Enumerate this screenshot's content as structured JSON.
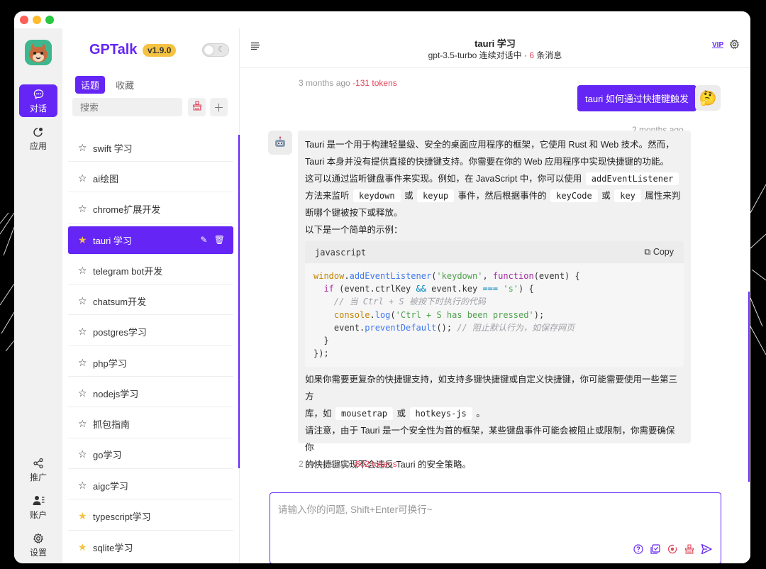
{
  "sidebar_rail": {
    "items": [
      {
        "label": "对话",
        "icon": "chat-bubble-icon",
        "active": true
      },
      {
        "label": "应用",
        "icon": "apps-icon",
        "active": false
      },
      {
        "label": "推广",
        "icon": "share-icon",
        "active": false
      },
      {
        "label": "账户",
        "icon": "account-icon",
        "active": false
      },
      {
        "label": "设置",
        "icon": "settings-icon",
        "active": false
      }
    ]
  },
  "sidebar": {
    "brand": "GPTalk",
    "version": "v1.9.0",
    "tabs": [
      {
        "label": "话题",
        "active": true
      },
      {
        "label": "收藏",
        "active": false
      }
    ],
    "search_placeholder": "搜索",
    "conversations": [
      {
        "title": "swift 学习",
        "starred": false,
        "active": false
      },
      {
        "title": "ai绘图",
        "starred": false,
        "active": false
      },
      {
        "title": "chrome扩展开发",
        "starred": false,
        "active": false
      },
      {
        "title": "tauri 学习",
        "starred": true,
        "active": true
      },
      {
        "title": "telegram bot开发",
        "starred": false,
        "active": false
      },
      {
        "title": "chatsum开发",
        "starred": false,
        "active": false
      },
      {
        "title": "postgres学习",
        "starred": false,
        "active": false
      },
      {
        "title": "php学习",
        "starred": false,
        "active": false
      },
      {
        "title": "nodejs学习",
        "starred": false,
        "active": false
      },
      {
        "title": "抓包指南",
        "starred": false,
        "active": false
      },
      {
        "title": "go学习",
        "starred": false,
        "active": false
      },
      {
        "title": "aigc学习",
        "starred": false,
        "active": false
      },
      {
        "title": "typescript学习",
        "starred": true,
        "active": false
      },
      {
        "title": "sqlite学习",
        "starred": true,
        "active": false
      }
    ]
  },
  "header": {
    "title": "tauri 学习",
    "model": "gpt-3.5-turbo",
    "mode": "连续对话中",
    "separator": "·",
    "message_count": "6",
    "message_suffix": "条消息",
    "vip_label": "VIP"
  },
  "messages": {
    "prev_meta": {
      "time": "3 months ago",
      "tokens": "-131 tokens"
    },
    "user": {
      "text": "tauri 如何通过快捷键触发",
      "time": "2 months ago",
      "avatar": "🤔"
    },
    "bot": {
      "p1": "Tauri 是一个用于构建轻量级、安全的桌面应用程序的框架，它使用 Rust 和 Web 技术。然而，",
      "p2": "Tauri 本身并没有提供直接的快捷键支持。你需要在你的 Web 应用程序中实现快捷键的功能。",
      "p3_pre": "这可以通过监听键盘事件来实现。例如，在 JavaScript 中，你可以使用",
      "code_addEventListener": "addEventListener",
      "p4_a": "方法来监听",
      "code_keydown": "keydown",
      "or1": "或",
      "code_keyup": "keyup",
      "p4_b": "事件，然后根据事件的",
      "code_keyCode": "keyCode",
      "or2": "或",
      "code_key": "key",
      "p4_c": "属性来判",
      "p5": "断哪个键被按下或释放。",
      "p6": "以下是一个简单的示例：",
      "code_lang": "javascript",
      "copy_label": "Copy",
      "p7": "如果你需要更复杂的快捷键支持，如支持多键快捷键或自定义快捷键，你可能需要使用一些第三方",
      "p8_a": "库，如",
      "code_mousetrap": "mousetrap",
      "or3": "或",
      "code_hotkeys": "hotkeys-js",
      "p8_b": "。",
      "p9": "请注意，由于 Tauri 是一个安全性为首的框架，某些键盘事件可能会被阻止或限制，你需要确保你",
      "p10": "的快捷键实现不会违反 Tauri 的安全策略。",
      "time": "2 months ago",
      "tokens": "-802 tokens"
    }
  },
  "composer": {
    "placeholder": "请输入你的问题, Shift+Enter可换行~"
  },
  "colors": {
    "accent": "#6526f5",
    "token_red": "#e0455b",
    "star_yellow": "#f5c242"
  }
}
